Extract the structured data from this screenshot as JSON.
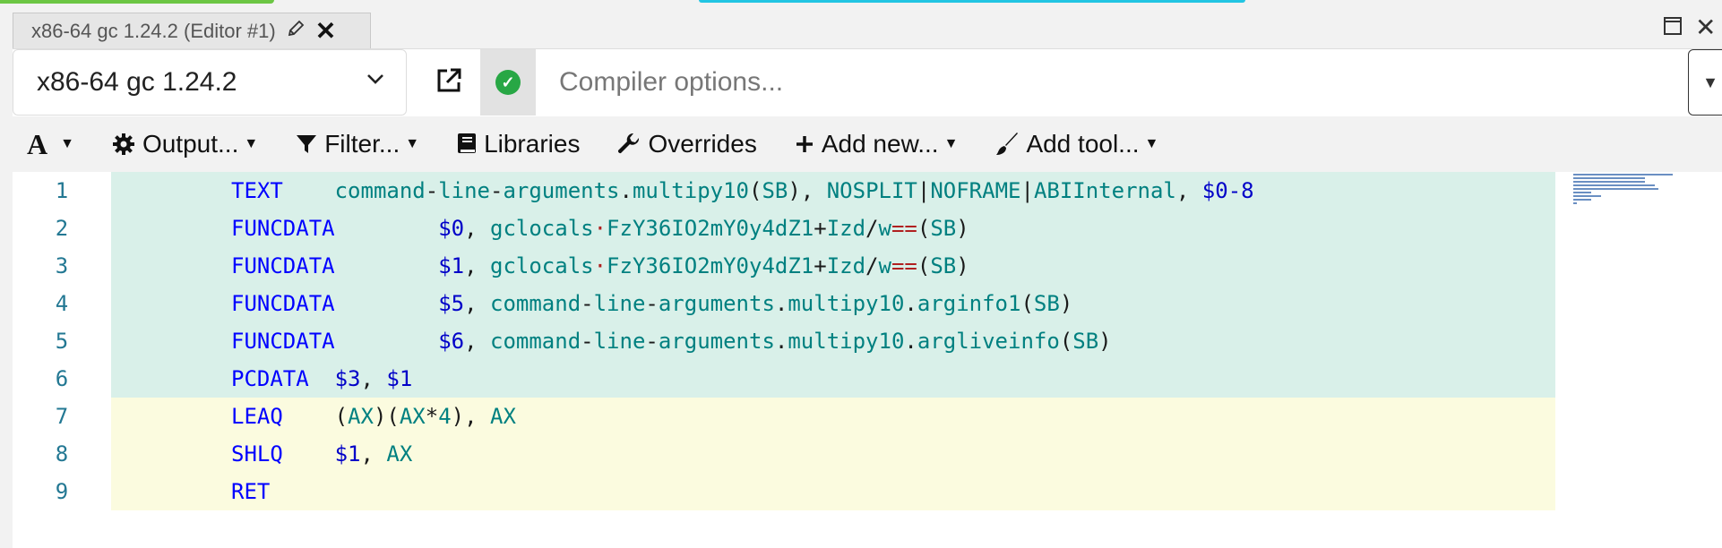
{
  "tab": {
    "title": "x86-64 gc 1.24.2 (Editor #1)"
  },
  "compiler": {
    "name": "x86-64 gc 1.24.2",
    "options_placeholder": "Compiler options..."
  },
  "toolbar": {
    "output": "Output...",
    "filter": "Filter...",
    "libraries": "Libraries",
    "overrides": "Overrides",
    "add_new": "Add new...",
    "add_tool": "Add tool..."
  },
  "colors": {
    "highlight_green": "#d9f0e9",
    "highlight_yellow": "#fbfbdf",
    "status_ok": "#28a745",
    "keyword": "#0000ff",
    "identifier": "#008080"
  },
  "icons": [
    "font-size-icon",
    "gear-icon",
    "filter-icon",
    "book-icon",
    "wrench-icon",
    "plus-icon",
    "brush-icon",
    "popout-icon",
    "check-icon",
    "pencil-icon",
    "close-icon",
    "maximize-icon"
  ],
  "code": {
    "lines": [
      {
        "num": "1",
        "instr": "TEXT",
        "pad": "    ",
        "args": "command-line-arguments.multipy10(SB), NOSPLIT|NOFRAME|ABIInternal, $0-8",
        "highlight": "green"
      },
      {
        "num": "2",
        "instr": "FUNCDATA",
        "pad": "        ",
        "args": "$0, gclocals·FzY36IO2mY0y4dZ1+Izd/w==(SB)",
        "highlight": "green"
      },
      {
        "num": "3",
        "instr": "FUNCDATA",
        "pad": "        ",
        "args": "$1, gclocals·FzY36IO2mY0y4dZ1+Izd/w==(SB)",
        "highlight": "green"
      },
      {
        "num": "4",
        "instr": "FUNCDATA",
        "pad": "        ",
        "args": "$5, command-line-arguments.multipy10.arginfo1(SB)",
        "highlight": "green"
      },
      {
        "num": "5",
        "instr": "FUNCDATA",
        "pad": "        ",
        "args": "$6, command-line-arguments.multipy10.argliveinfo(SB)",
        "highlight": "green"
      },
      {
        "num": "6",
        "instr": "PCDATA",
        "pad": "  ",
        "args": "$3, $1",
        "highlight": "green"
      },
      {
        "num": "7",
        "instr": "LEAQ",
        "pad": "    ",
        "args": "(AX)(AX*4), AX",
        "highlight": "yellow"
      },
      {
        "num": "8",
        "instr": "SHLQ",
        "pad": "    ",
        "args": "$1, AX",
        "highlight": "yellow"
      },
      {
        "num": "9",
        "instr": "RET",
        "pad": "",
        "args": "",
        "highlight": "yellow"
      }
    ]
  }
}
